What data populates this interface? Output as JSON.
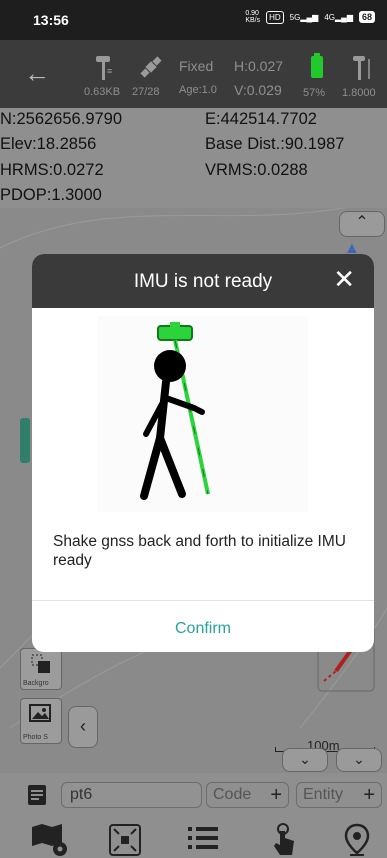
{
  "status_bar": {
    "time": "13:56",
    "net_speed": "0.90\nKB/s",
    "hd_label": "HD",
    "net_type": "5G",
    "net_type2": "4G",
    "battery": "68"
  },
  "toolbar": {
    "data_rate": "0.63KB",
    "satellites": "27/28",
    "solution": "Fixed",
    "age": "Age:1.0",
    "h_precision": "H:0.027",
    "v_precision": "V:0.029",
    "battery_pct": "57%",
    "pole_height": "1.8000"
  },
  "coords": {
    "north": "N:2562656.9790",
    "east": "E:442514.7702",
    "elev": "Elev:18.2856",
    "base_dist": "Base Dist.:90.1987",
    "hrms": "HRMS:0.0272",
    "vrms": "VRMS:0.0288",
    "pdop": "PDOP:1.3000"
  },
  "map": {
    "background_label": "Backgro",
    "photo_label": "Photo S",
    "scale": "100m"
  },
  "dialog": {
    "title": "IMU is not ready",
    "message": "Shake gnss back and forth to initialize IMU ready",
    "confirm": "Confirm"
  },
  "input_bar": {
    "point_name": "pt6",
    "code_label": "Code",
    "entity_label": "Entity"
  },
  "colors": {
    "accent": "#27a59a",
    "pole_green": "#22c92a",
    "toolbar_bg": "#3b3b3b",
    "dialog_header": "#3a3a3a"
  }
}
